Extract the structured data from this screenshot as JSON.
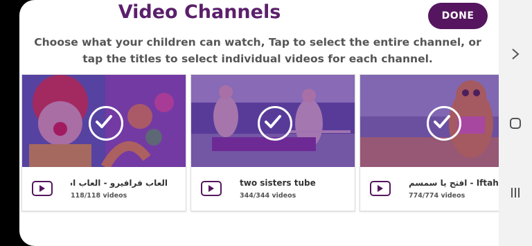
{
  "header": {
    "title": "Video Channels",
    "done_label": "DONE",
    "subtitle": "Choose what your children can watch, Tap to select the entire channel, or tap the titles to select individual videos for each channel."
  },
  "channels": [
    {
      "name": "العاب فرافيرو - العاب اطفال",
      "count": "118/118 videos"
    },
    {
      "name": "two sisters tube",
      "count": "344/344 videos"
    },
    {
      "name": "افتح يا سمسم - Iftahyasimsim",
      "count": "774/774 videos"
    }
  ],
  "colors": {
    "accent": "#55165f",
    "title": "#5b1f6b",
    "overlay": "#6e1e8c"
  },
  "icons": {
    "check": "check-circle-icon",
    "channel": "tv-play-icon"
  }
}
